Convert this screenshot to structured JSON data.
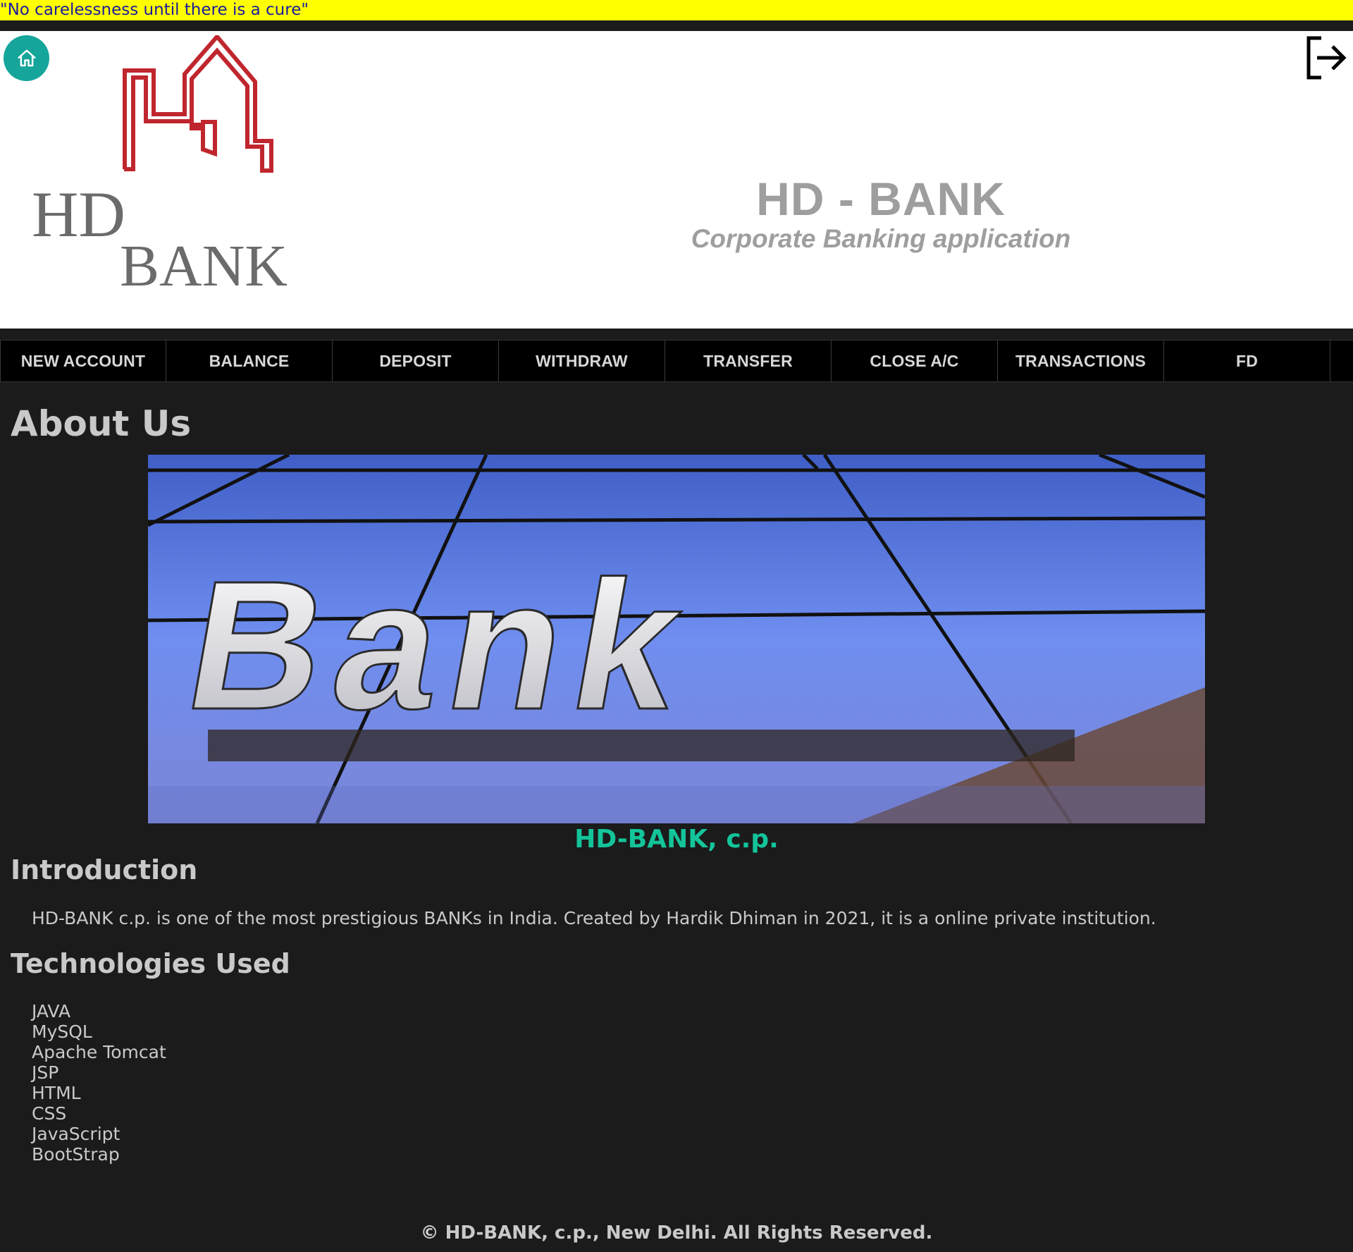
{
  "marquee": {
    "text": "\"No carelessness until there is a cure\""
  },
  "header": {
    "title": "HD - BANK",
    "subtitle": "Corporate Banking application",
    "logo_line1": "HD",
    "logo_line2": "BANK"
  },
  "icons": {
    "home": "home-icon",
    "logout": "logout-icon"
  },
  "nav": {
    "items": [
      {
        "label": "NEW ACCOUNT"
      },
      {
        "label": "BALANCE"
      },
      {
        "label": "DEPOSIT"
      },
      {
        "label": "WITHDRAW"
      },
      {
        "label": "TRANSFER"
      },
      {
        "label": "CLOSE A/C"
      },
      {
        "label": "TRANSACTIONS"
      },
      {
        "label": "FD"
      }
    ]
  },
  "main": {
    "heading": "About Us",
    "hero_word": "Bank",
    "caption": "HD-BANK, c.p.",
    "intro_heading": "Introduction",
    "intro_text": "HD-BANK c.p. is one of the most prestigious BANKs in India. Created by Hardik Dhiman in 2021, it is a online private institution.",
    "tech_heading": "Technologies Used",
    "technologies": [
      "JAVA",
      "MySQL",
      "Apache Tomcat",
      "JSP",
      "HTML",
      "CSS",
      "JavaScript",
      "BootStrap"
    ]
  },
  "footer": {
    "text": "© HD-BANK, c.p., New Delhi. All Rights Reserved."
  },
  "colors": {
    "marquee_bg": "#ffff00",
    "marquee_text": "#1a1aa0",
    "home_button": "#15a59b",
    "logo_red": "#c0262e",
    "caption_green": "#13c49a",
    "page_bg": "#1b1b1b"
  }
}
